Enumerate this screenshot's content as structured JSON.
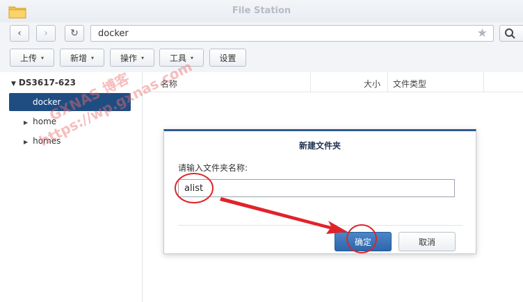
{
  "window": {
    "title": "File Station",
    "app_icon": "folder-icon"
  },
  "nav": {
    "back_icon": "‹",
    "forward_icon": "›",
    "refresh_icon": "↻",
    "path": "docker",
    "favorite_icon": "★",
    "search_icon": "⚲"
  },
  "toolbar": {
    "upload": "上传",
    "create": "新增",
    "action": "操作",
    "tools": "工具",
    "settings": "设置",
    "caret": "▾"
  },
  "sidebar": {
    "root": "DS3617-623",
    "expand_glyph": "▼",
    "collapsed_glyph": "▶",
    "selected": "docker",
    "items": [
      {
        "label": "home"
      },
      {
        "label": "homes"
      }
    ]
  },
  "list": {
    "columns": [
      "名称",
      "大小",
      "文件类型"
    ]
  },
  "dialog": {
    "title": "新建文件夹",
    "prompt": "请输入文件夹名称:",
    "input_value": "alist",
    "ok": "确定",
    "cancel": "取消"
  },
  "watermark": {
    "line1": "GXNAS 博客",
    "line2": "https://wp.gxnas.com"
  },
  "colors": {
    "accent": "#2d5a91",
    "selected_bg": "#1f4d82",
    "ok_button": "#3a74b8",
    "annotation": "#e0232a"
  }
}
